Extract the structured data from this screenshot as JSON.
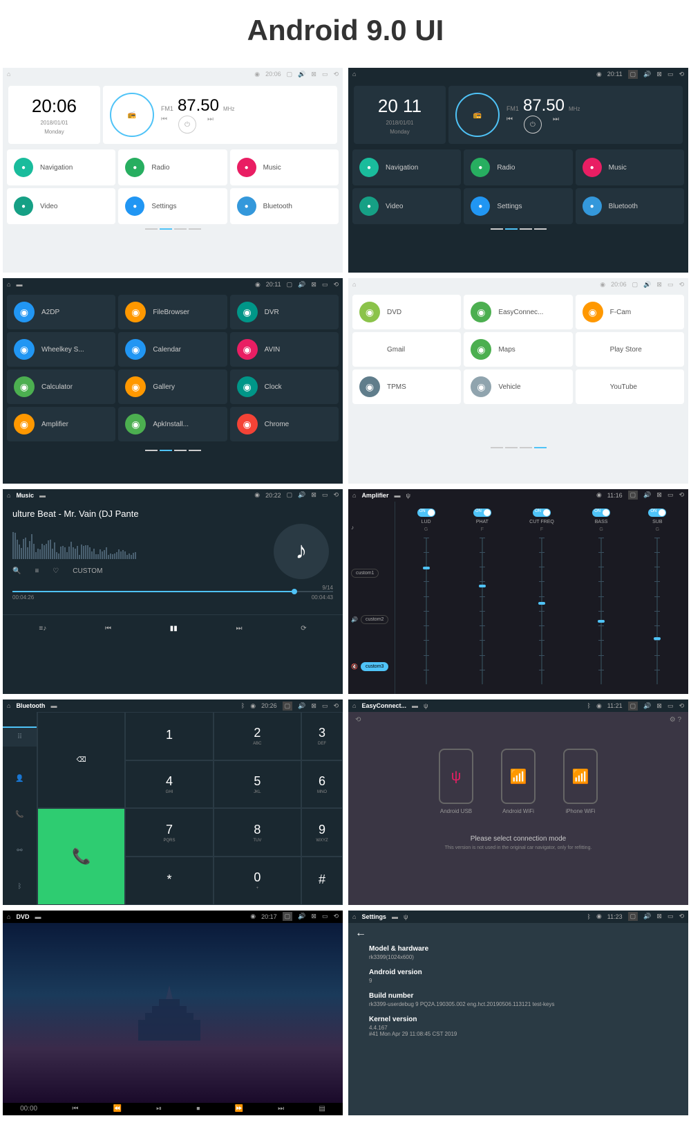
{
  "title": "Android 9.0 UI",
  "home": {
    "time": "20:06",
    "time2": "20 11",
    "date": "2018/01/01",
    "day": "Monday",
    "fm": "FM1",
    "freq": "87.50",
    "unit": "MHz",
    "tiles": [
      {
        "label": "Navigation",
        "color": "#1abc9c"
      },
      {
        "label": "Radio",
        "color": "#27ae60"
      },
      {
        "label": "Music",
        "color": "#e91e63"
      },
      {
        "label": "Video",
        "color": "#16a085"
      },
      {
        "label": "Settings",
        "color": "#2196f3"
      },
      {
        "label": "Bluetooth",
        "color": "#3498db"
      }
    ]
  },
  "status": {
    "t1": "20:06",
    "t2": "20:11",
    "t3": "20:11",
    "t4": "20:06",
    "t5": "20:22",
    "t6": "11:16",
    "t7": "20:26",
    "t8": "11:21",
    "t9": "20:17",
    "t10": "11:23"
  },
  "apps1": [
    {
      "label": "A2DP",
      "color": "#2196f3"
    },
    {
      "label": "FileBrowser",
      "color": "#ff9800"
    },
    {
      "label": "DVR",
      "color": "#009688"
    },
    {
      "label": "Wheelkey S...",
      "color": "#2196f3"
    },
    {
      "label": "Calendar",
      "color": "#2196f3"
    },
    {
      "label": "AVIN",
      "color": "#e91e63"
    },
    {
      "label": "Calculator",
      "color": "#4caf50"
    },
    {
      "label": "Gallery",
      "color": "#ff9800"
    },
    {
      "label": "Clock",
      "color": "#009688"
    },
    {
      "label": "Amplifier",
      "color": "#ff9800"
    },
    {
      "label": "ApkInstall...",
      "color": "#4caf50"
    },
    {
      "label": "Chrome",
      "color": "#f44336"
    }
  ],
  "apps2": [
    {
      "label": "DVD",
      "color": "#8bc34a"
    },
    {
      "label": "EasyConnec...",
      "color": "#4caf50"
    },
    {
      "label": "F-Cam",
      "color": "#ff9800"
    },
    {
      "label": "Gmail",
      "color": "#fff"
    },
    {
      "label": "Maps",
      "color": "#4caf50"
    },
    {
      "label": "Play Store",
      "color": "#fff"
    },
    {
      "label": "TPMS",
      "color": "#607d8b"
    },
    {
      "label": "Vehicle",
      "color": "#90a4ae"
    },
    {
      "label": "YouTube",
      "color": "#fff"
    }
  ],
  "music": {
    "title": "Music",
    "track": "ulture Beat - Mr. Vain (DJ Pante",
    "custom": "CUSTOM",
    "counter": "9/14",
    "elapsed": "00:04:26",
    "total": "00:04:43"
  },
  "amp": {
    "title": "Amplifier",
    "presets": [
      "custom1",
      "custom2",
      "custom3"
    ],
    "on": "ON",
    "cols": [
      {
        "name": "LUD",
        "v": "G"
      },
      {
        "name": "PHAT",
        "v": "F"
      },
      {
        "name": "CUT FREQ",
        "v": "F"
      },
      {
        "name": "BASS",
        "v": "G"
      },
      {
        "name": "SUB",
        "v": "G"
      }
    ]
  },
  "bt": {
    "title": "Bluetooth",
    "keys": [
      {
        "n": "1",
        "s": ""
      },
      {
        "n": "2",
        "s": "ABC"
      },
      {
        "n": "3",
        "s": "DEF"
      },
      {
        "n": "4",
        "s": "GHI"
      },
      {
        "n": "5",
        "s": "JKL"
      },
      {
        "n": "6",
        "s": "MNO"
      },
      {
        "n": "7",
        "s": "PQRS"
      },
      {
        "n": "8",
        "s": "TUV"
      },
      {
        "n": "9",
        "s": "WXYZ"
      },
      {
        "n": "*",
        "s": ""
      },
      {
        "n": "0",
        "s": "+"
      },
      {
        "n": "#",
        "s": ""
      }
    ]
  },
  "ec": {
    "title": "EasyConnect...",
    "opts": [
      "Android USB",
      "Android WiFi",
      "iPhone WiFi"
    ],
    "msg": "Please select connection mode",
    "sub": "This version is not used in the original car navigator, only for refitting."
  },
  "dvd": {
    "title": "DVD",
    "time": "00:00"
  },
  "settings": {
    "title": "Settings",
    "items": [
      {
        "label": "Model & hardware",
        "value": "rk3399(1024x600)"
      },
      {
        "label": "Android version",
        "value": "9"
      },
      {
        "label": "Build number",
        "value": "rk3399-userdebug 9 PQ2A.190305.002 eng.hct.20190506.113121 test-keys"
      },
      {
        "label": "Kernel version",
        "value": "4.4.167\n#41 Mon Apr 29 11:08:45 CST 2019"
      }
    ]
  }
}
